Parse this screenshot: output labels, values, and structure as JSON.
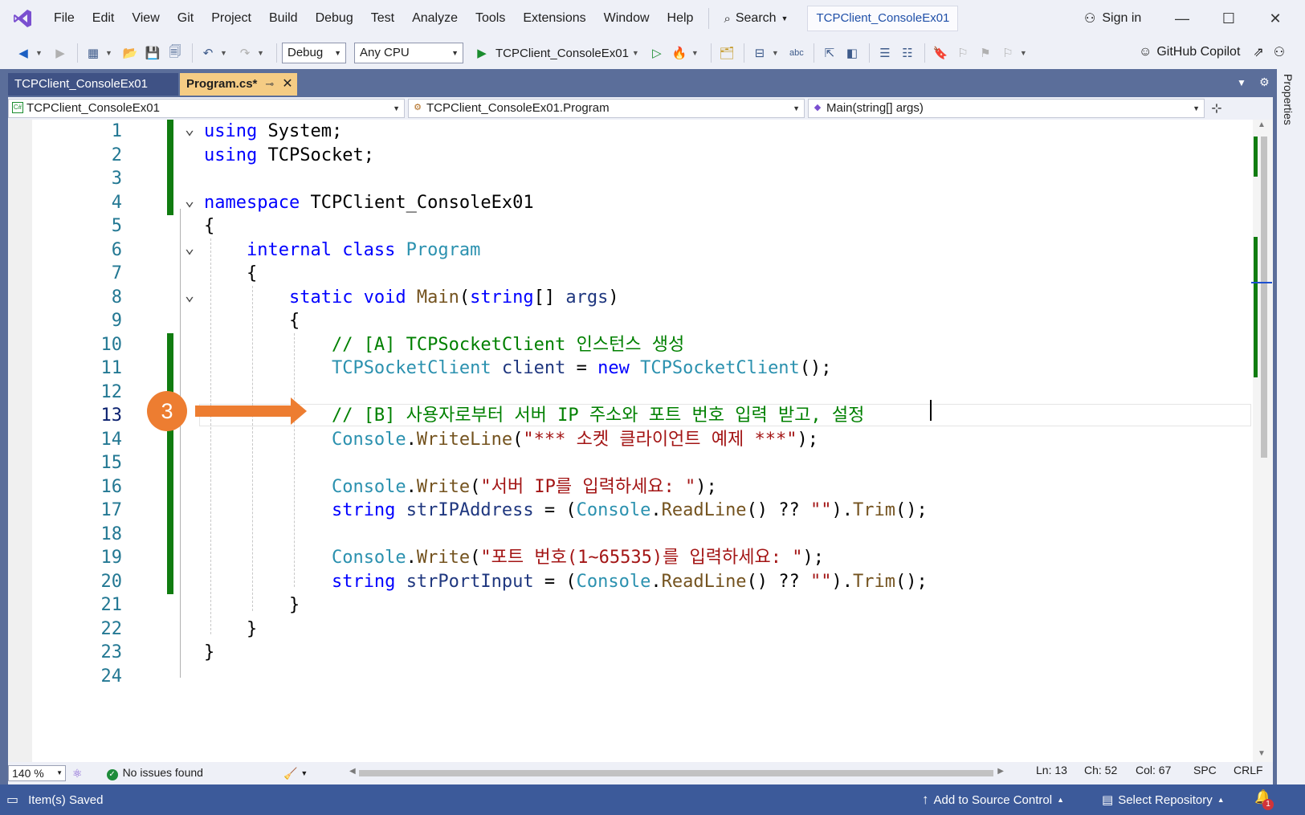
{
  "menu": {
    "items": [
      "File",
      "Edit",
      "View",
      "Git",
      "Project",
      "Build",
      "Debug",
      "Test",
      "Analyze",
      "Tools",
      "Extensions",
      "Window",
      "Help"
    ],
    "search_label": "Search",
    "solution_name": "TCPClient_ConsoleEx01",
    "signin_label": "Sign in"
  },
  "toolbar": {
    "config": "Debug",
    "platform": "Any CPU",
    "run_target": "TCPClient_ConsoleEx01",
    "copilot_label": "GitHub Copilot"
  },
  "tabs": [
    {
      "label": "TCPClient_ConsoleEx01",
      "active": false
    },
    {
      "label": "Program.cs*",
      "active": true
    }
  ],
  "properties_label": "Properties",
  "navbar": {
    "project": "TCPClient_ConsoleEx01",
    "type": "TCPClient_ConsoleEx01.Program",
    "member": "Main(string[] args)"
  },
  "editor": {
    "current_line": 13,
    "badge_number": "3",
    "lines": [
      {
        "n": "1",
        "tokens": [
          [
            "kw",
            "using"
          ],
          [
            "",
            "System;"
          ]
        ]
      },
      {
        "n": "2",
        "tokens": [
          [
            "kw",
            "using"
          ],
          [
            "",
            "TCPSocket;"
          ]
        ]
      },
      {
        "n": "3",
        "tokens": []
      },
      {
        "n": "4",
        "tokens": [
          [
            "kw",
            "namespace"
          ],
          [
            "",
            "TCPClient_ConsoleEx01"
          ]
        ]
      },
      {
        "n": "5",
        "tokens": [
          [
            "",
            "{"
          ]
        ]
      },
      {
        "n": "6",
        "tokens": [
          [
            "",
            "    "
          ],
          [
            "kw",
            "internal class"
          ],
          [
            "",
            " "
          ],
          [
            "ty",
            "Program"
          ]
        ]
      },
      {
        "n": "7",
        "tokens": [
          [
            "",
            "    {"
          ]
        ]
      },
      {
        "n": "8",
        "tokens": [
          [
            "",
            "        "
          ],
          [
            "kw",
            "static void"
          ],
          [
            "",
            " "
          ],
          [
            "fn",
            "Main"
          ],
          [
            "",
            "("
          ],
          [
            "kw",
            "string"
          ],
          [
            "",
            "[] "
          ],
          [
            "id",
            "args"
          ],
          [
            "",
            ")"
          ]
        ]
      },
      {
        "n": "9",
        "tokens": [
          [
            "",
            "        {"
          ]
        ]
      },
      {
        "n": "10",
        "tokens": [
          [
            "",
            "            "
          ],
          [
            "cm",
            "// [A] TCPSocketClient 인스턴스 생성"
          ]
        ]
      },
      {
        "n": "11",
        "tokens": [
          [
            "",
            "            "
          ],
          [
            "ty",
            "TCPSocketClient"
          ],
          [
            "",
            " "
          ],
          [
            "id",
            "client"
          ],
          [
            "",
            " = "
          ],
          [
            "kw",
            "new"
          ],
          [
            "",
            " "
          ],
          [
            "ty",
            "TCPSocketClient"
          ],
          [
            "",
            "();"
          ]
        ]
      },
      {
        "n": "12",
        "tokens": []
      },
      {
        "n": "13",
        "tokens": [
          [
            "",
            "            "
          ],
          [
            "cm",
            "// [B] 사용자로부터 서버 IP 주소와 포트 번호 입력 받고, 설정"
          ]
        ]
      },
      {
        "n": "14",
        "tokens": [
          [
            "",
            "            "
          ],
          [
            "ty",
            "Console"
          ],
          [
            "",
            "."
          ],
          [
            "fn",
            "WriteLine"
          ],
          [
            "",
            "("
          ],
          [
            "st",
            "\"*** 소켓 클라이언트 예제 ***\""
          ],
          [
            "",
            ");"
          ]
        ]
      },
      {
        "n": "15",
        "tokens": []
      },
      {
        "n": "16",
        "tokens": [
          [
            "",
            "            "
          ],
          [
            "ty",
            "Console"
          ],
          [
            "",
            "."
          ],
          [
            "fn",
            "Write"
          ],
          [
            "",
            "("
          ],
          [
            "st",
            "\"서버 IP를 입력하세요: \""
          ],
          [
            "",
            ");"
          ]
        ]
      },
      {
        "n": "17",
        "tokens": [
          [
            "",
            "            "
          ],
          [
            "kw",
            "string"
          ],
          [
            "",
            " "
          ],
          [
            "id",
            "strIPAddress"
          ],
          [
            "",
            " = ("
          ],
          [
            "ty",
            "Console"
          ],
          [
            "",
            "."
          ],
          [
            "fn",
            "ReadLine"
          ],
          [
            "",
            "() ?? "
          ],
          [
            "st",
            "\"\""
          ],
          [
            "",
            ")."
          ],
          [
            "fn",
            "Trim"
          ],
          [
            "",
            "();"
          ]
        ]
      },
      {
        "n": "18",
        "tokens": []
      },
      {
        "n": "19",
        "tokens": [
          [
            "",
            "            "
          ],
          [
            "ty",
            "Console"
          ],
          [
            "",
            "."
          ],
          [
            "fn",
            "Write"
          ],
          [
            "",
            "("
          ],
          [
            "st",
            "\"포트 번호(1~65535)를 입력하세요: \""
          ],
          [
            "",
            ");"
          ]
        ]
      },
      {
        "n": "20",
        "tokens": [
          [
            "",
            "            "
          ],
          [
            "kw",
            "string"
          ],
          [
            "",
            " "
          ],
          [
            "id",
            "strPortInput"
          ],
          [
            "",
            " = ("
          ],
          [
            "ty",
            "Console"
          ],
          [
            "",
            "."
          ],
          [
            "fn",
            "ReadLine"
          ],
          [
            "",
            "() ?? "
          ],
          [
            "st",
            "\"\""
          ],
          [
            "",
            ")."
          ],
          [
            "fn",
            "Trim"
          ],
          [
            "",
            "();"
          ]
        ]
      },
      {
        "n": "21",
        "tokens": [
          [
            "",
            "        }"
          ]
        ]
      },
      {
        "n": "22",
        "tokens": [
          [
            "",
            "    }"
          ]
        ]
      },
      {
        "n": "23",
        "tokens": [
          [
            "",
            "}"
          ]
        ]
      },
      {
        "n": "24",
        "tokens": []
      }
    ]
  },
  "bottom": {
    "zoom": "140 %",
    "issues": "No issues found",
    "ln": "Ln: 13",
    "ch": "Ch: 52",
    "col": "Col: 67",
    "spc": "SPC",
    "crlf": "CRLF"
  },
  "status": {
    "message": "Item(s) Saved",
    "source_control": "Add to Source Control",
    "repository": "Select Repository",
    "notification_count": "1"
  }
}
